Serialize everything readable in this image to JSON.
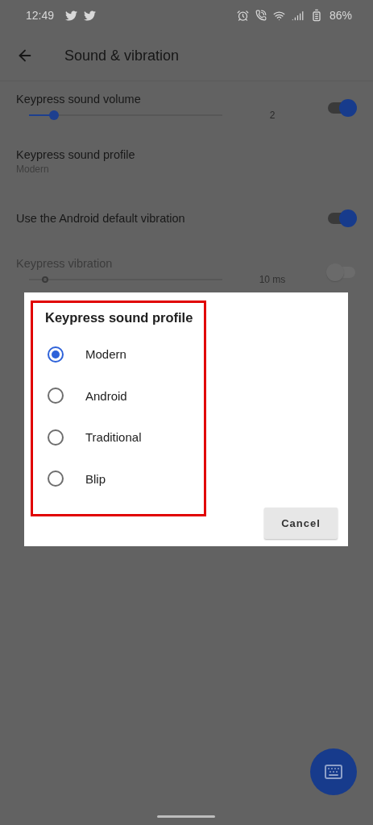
{
  "status_bar": {
    "time": "12:49",
    "battery": "86%"
  },
  "toolbar": {
    "title": "Sound & vibration"
  },
  "settings": [
    {
      "kind": "slider",
      "title": "Keypress sound volume",
      "level": 0.13,
      "reading": "2",
      "on": true,
      "disabled": false
    },
    {
      "kind": "summary",
      "title": "Keypress sound profile",
      "summary": "Modern"
    },
    {
      "kind": "switch",
      "title": "Use the Android default vibration",
      "on": true
    },
    {
      "kind": "slider",
      "title": "Keypress vibration",
      "level": 0.09,
      "reading": "10 ms",
      "on": false,
      "disabled": true
    }
  ],
  "dialog": {
    "title": "Keypress sound profile",
    "highlighted": true,
    "options": [
      {
        "label": "Modern",
        "selected": true
      },
      {
        "label": "Android",
        "selected": false
      },
      {
        "label": "Traditional",
        "selected": false
      },
      {
        "label": "Blip",
        "selected": false
      }
    ],
    "buttons": [
      "Cancel"
    ]
  }
}
